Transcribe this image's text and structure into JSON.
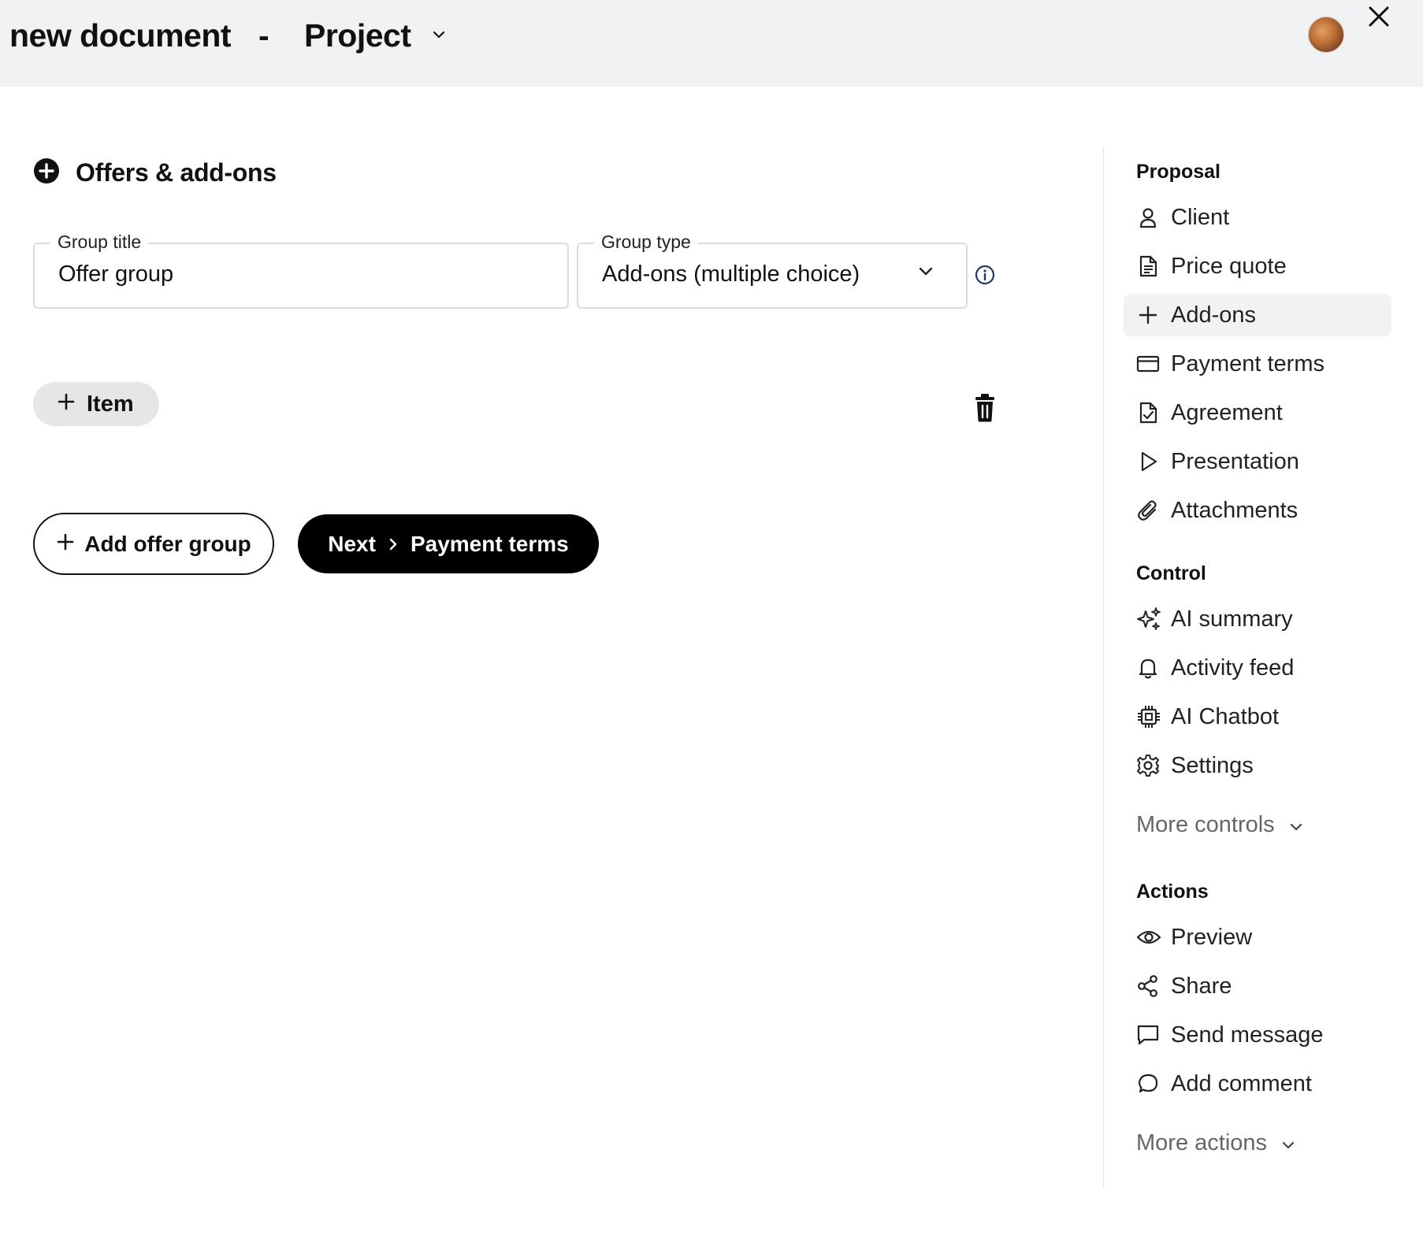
{
  "header": {
    "document_title": "new document",
    "separator": "-",
    "project_label": "Project"
  },
  "main": {
    "section_title": "Offers & add-ons",
    "group_title": {
      "label": "Group title",
      "value": "Offer group"
    },
    "group_type": {
      "label": "Group type",
      "value": "Add-ons (multiple choice)"
    },
    "item_button": "Item",
    "add_offer_group_button": "Add offer group",
    "next_button": {
      "label": "Next",
      "target": "Payment terms"
    }
  },
  "sidebar": {
    "proposal": {
      "heading": "Proposal",
      "items": [
        {
          "label": "Client",
          "icon": "user-icon"
        },
        {
          "label": "Price quote",
          "icon": "document-icon"
        },
        {
          "label": "Add-ons",
          "icon": "plus-icon",
          "active": true
        },
        {
          "label": "Payment terms",
          "icon": "credit-card-icon"
        },
        {
          "label": "Agreement",
          "icon": "document-check-icon"
        },
        {
          "label": "Presentation",
          "icon": "play-icon"
        },
        {
          "label": "Attachments",
          "icon": "paperclip-icon"
        }
      ]
    },
    "control": {
      "heading": "Control",
      "items": [
        {
          "label": "AI summary",
          "icon": "sparkles-icon"
        },
        {
          "label": "Activity feed",
          "icon": "bell-icon"
        },
        {
          "label": "AI Chatbot",
          "icon": "chip-icon"
        },
        {
          "label": "Settings",
          "icon": "gear-icon"
        }
      ],
      "more": "More controls"
    },
    "actions": {
      "heading": "Actions",
      "items": [
        {
          "label": "Preview",
          "icon": "eye-icon"
        },
        {
          "label": "Share",
          "icon": "share-icon"
        },
        {
          "label": "Send message",
          "icon": "message-square-icon"
        },
        {
          "label": "Add comment",
          "icon": "message-circle-icon"
        }
      ],
      "more": "More actions"
    }
  }
}
